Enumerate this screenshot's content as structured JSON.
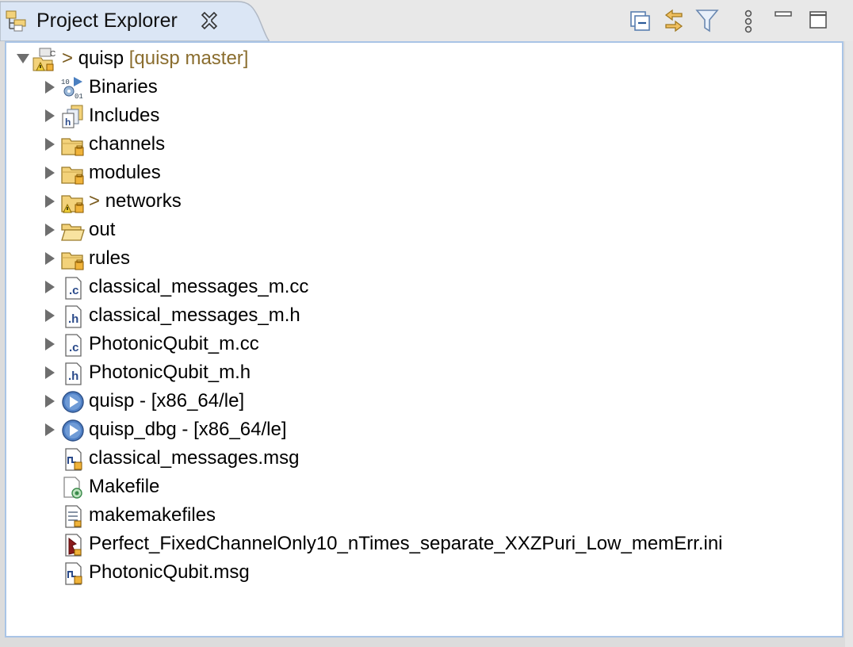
{
  "view": {
    "title": "Project Explorer",
    "icon": "project-explorer-icon",
    "toolbar": [
      {
        "name": "collapse-all-icon"
      },
      {
        "name": "link-with-editor-icon"
      },
      {
        "name": "filter-icon"
      },
      {
        "name": "view-menu-icon"
      },
      {
        "name": "minimize-icon"
      },
      {
        "name": "maximize-icon"
      }
    ]
  },
  "tree": {
    "project": {
      "prefix": ">",
      "name": "quisp",
      "decoration": "[quisp master]"
    },
    "items": [
      {
        "label": "Binaries",
        "icon": "binaries-icon",
        "expandable": true
      },
      {
        "label": "Includes",
        "icon": "includes-icon",
        "expandable": true
      },
      {
        "label": "channels",
        "icon": "folder-icon",
        "expandable": true
      },
      {
        "label": "modules",
        "icon": "folder-icon",
        "expandable": true
      },
      {
        "prefix": ">",
        "label": "networks",
        "icon": "folder-warning-icon",
        "expandable": true
      },
      {
        "label": "out",
        "icon": "folder-open-icon",
        "expandable": true
      },
      {
        "label": "rules",
        "icon": "folder-icon",
        "expandable": true
      },
      {
        "label": "classical_messages_m.cc",
        "icon": "c-source-file-icon",
        "expandable": true
      },
      {
        "label": "classical_messages_m.h",
        "icon": "header-file-icon",
        "expandable": true
      },
      {
        "label": "PhotonicQubit_m.cc",
        "icon": "c-source-file-icon",
        "expandable": true
      },
      {
        "label": "PhotonicQubit_m.h",
        "icon": "header-file-icon",
        "expandable": true
      },
      {
        "label": "quisp - [x86_64/le]",
        "icon": "executable-icon",
        "expandable": true
      },
      {
        "label": "quisp_dbg - [x86_64/le]",
        "icon": "executable-icon",
        "expandable": true
      },
      {
        "label": "classical_messages.msg",
        "icon": "msg-file-icon",
        "expandable": false
      },
      {
        "label": "Makefile",
        "icon": "makefile-icon",
        "expandable": false
      },
      {
        "label": "makemakefiles",
        "icon": "text-file-icon",
        "expandable": false
      },
      {
        "label": "Perfect_FixedChannelOnly10_nTimes_separate_XXZPuri_Low_memErr.ini",
        "icon": "ini-file-icon",
        "expandable": false
      },
      {
        "label": "PhotonicQubit.msg",
        "icon": "msg-file-icon",
        "expandable": false
      }
    ]
  },
  "colors": {
    "panel_border": "#a9c4e6",
    "decoration": "#8a6d2e",
    "tab_bg": "#dbe6f5"
  }
}
